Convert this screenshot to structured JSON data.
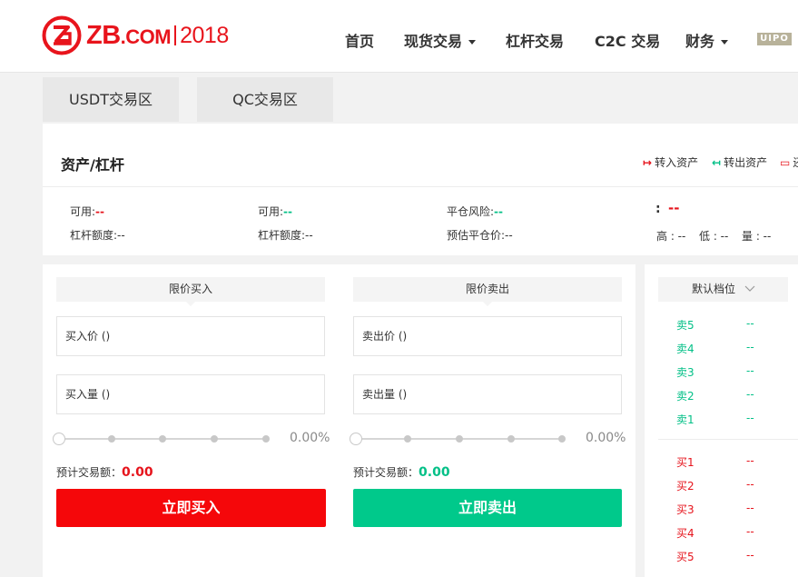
{
  "header": {
    "logo_brand": "ZB",
    "logo_domain": ".COM",
    "logo_year": "2018",
    "nav": [
      {
        "label": "首页",
        "dropdown": false
      },
      {
        "label": "现货交易",
        "dropdown": true
      },
      {
        "label": "杠杆交易",
        "dropdown": false
      },
      {
        "label": "C2C 交易",
        "dropdown": false
      },
      {
        "label": "财务",
        "dropdown": true
      }
    ],
    "badge": "UIPO"
  },
  "tabs": [
    "USDT交易区",
    "QC交易区"
  ],
  "asset": {
    "title": "资产/杠杆",
    "actions": [
      {
        "label": "转入资产",
        "icon": "transfer-in-icon"
      },
      {
        "label": "转出资产",
        "icon": "transfer-out-icon"
      },
      {
        "label": "还",
        "icon": "repay-icon"
      }
    ],
    "col1": {
      "available_label": "可用:",
      "available_value": "--",
      "limit_label": "杠杆额度:",
      "limit_value": "--"
    },
    "col2": {
      "available_label": "可用:",
      "available_value": "--",
      "limit_label": "杠杆额度:",
      "limit_value": "--"
    },
    "col3": {
      "risk_label": "平仓风险:",
      "risk_value": "--",
      "est_label": "预估平仓价:",
      "est_value": "--"
    },
    "col4": {
      "colon": ":",
      "price": "--",
      "high_label": "高 : --",
      "low_label": "低 : --",
      "vol_label": "量 : --"
    }
  },
  "buy": {
    "head": "限价买入",
    "price_placeholder": "买入价 ()",
    "amount_placeholder": "买入量 ()",
    "percent": "0.00%",
    "est_label": "预计交易额：",
    "est_value": "0.00",
    "button": "立即买入"
  },
  "sell": {
    "head": "限价卖出",
    "price_placeholder": "卖出价 ()",
    "amount_placeholder": "卖出量 ()",
    "percent": "0.00%",
    "est_label": "预计交易额：",
    "est_value": "0.00",
    "button": "立即卖出"
  },
  "orderbook": {
    "head": "默认档位",
    "asks": [
      {
        "label": "卖5",
        "value": "--"
      },
      {
        "label": "卖4",
        "value": "--"
      },
      {
        "label": "卖3",
        "value": "--"
      },
      {
        "label": "卖2",
        "value": "--"
      },
      {
        "label": "卖1",
        "value": "--"
      }
    ],
    "bids": [
      {
        "label": "买1",
        "value": "--"
      },
      {
        "label": "买2",
        "value": "--"
      },
      {
        "label": "买3",
        "value": "--"
      },
      {
        "label": "买4",
        "value": "--"
      },
      {
        "label": "买5",
        "value": "--"
      }
    ]
  },
  "colors": {
    "red": "#e6141c",
    "green": "#03c087",
    "brand": "#e8141c"
  }
}
